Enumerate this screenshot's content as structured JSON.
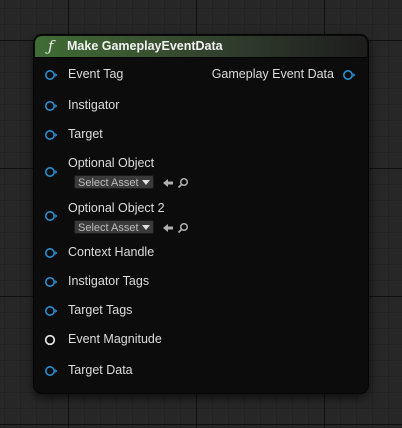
{
  "node": {
    "title": "Make GameplayEventData",
    "function_icon": "ƒ",
    "accent_color": "#3f6c34",
    "inputs": [
      {
        "label": "Event Tag",
        "pin_color": "#2a8fd0"
      },
      {
        "label": "Instigator",
        "pin_color": "#2a8fd0"
      },
      {
        "label": "Target",
        "pin_color": "#2a8fd0"
      },
      {
        "label": "Optional Object",
        "pin_color": "#2a8fd0",
        "asset_select": "Select Asset"
      },
      {
        "label": "Optional Object 2",
        "pin_color": "#2a8fd0",
        "asset_select": "Select Asset"
      },
      {
        "label": "Context Handle",
        "pin_color": "#2a8fd0"
      },
      {
        "label": "Instigator Tags",
        "pin_color": "#2a8fd0"
      },
      {
        "label": "Target Tags",
        "pin_color": "#2a8fd0"
      },
      {
        "label": "Event Magnitude",
        "pin_color": "#e8e8e8"
      },
      {
        "label": "Target Data",
        "pin_color": "#2a8fd0"
      }
    ],
    "outputs": [
      {
        "label": "Gameplay Event Data",
        "pin_color": "#2a8fd0"
      }
    ]
  }
}
